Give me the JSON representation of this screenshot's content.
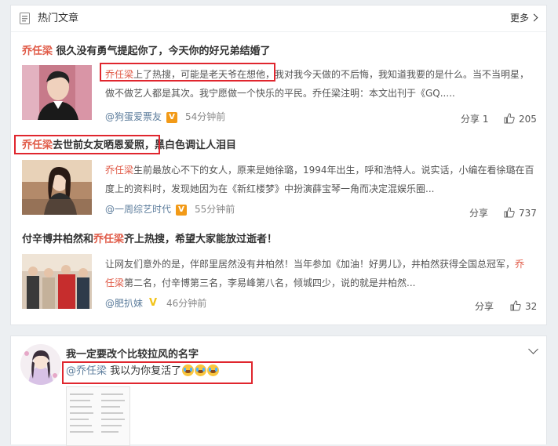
{
  "hot": {
    "header_title": "热门文章",
    "more_label": "更多",
    "articles": [
      {
        "title_highlight": "乔任梁",
        "title_rest": " 很久没有勇气提起你了，今天你的好兄弟结婚了",
        "excerpt_highlight": "乔任梁",
        "excerpt_line1_rest": "上了热搜，可能是老天爷在想他，我对我今天做的不后悔，我知道我要的是什么。当不当明星，",
        "excerpt_line2": "做不做艺人都是其次。我宁愿做一个快乐的平民。乔任梁注明：本文出刊于《GQ.....",
        "author": "@狗蛋爱票友",
        "time": "54分钟前",
        "share": "分享 1",
        "likes": "205"
      },
      {
        "title_highlight": "乔任梁",
        "title_rest": "去世前女友晒恩爱照，黑白色调让人泪目",
        "excerpt_highlight": "乔任梁",
        "excerpt_line1_rest": "生前最放心不下的女人，原来是她徐璐，1994年出生，呼和浩特人。说实话，小编在看徐璐在百",
        "excerpt_line2": "度上的资料时，发现她因为在《新红楼梦》中扮演薛宝琴一角而决定混娱乐圈...",
        "author": "@一周综艺时代",
        "time": "55分钟前",
        "share": "分享",
        "likes": "737"
      },
      {
        "title_pre": "付辛博井柏然和",
        "title_highlight": "乔任梁",
        "title_rest": "齐上热搜，希望大家能放过逝者！",
        "excerpt_line1": "让网友们意外的是，伴郎里居然没有井柏然！当年参加《加油！好男儿》，井柏然获得全国总冠军，",
        "excerpt_line1_hl": "乔",
        "excerpt_line2_hl": "任梁",
        "excerpt_line2_rest": "第二名，付辛博第三名，李易峰第八名，倾城四少，说的就是井柏然...",
        "author": "@肥扒妹",
        "time": "46分钟前",
        "share": "分享",
        "likes": "32"
      }
    ]
  },
  "post": {
    "author_name": "我一定要改个比较拉风的名字",
    "mention": "@乔任梁",
    "text": " 我以为你复活了"
  },
  "icons": {
    "header": "article-icon",
    "more": "chevron-right-icon",
    "verified": "verified-badge-icon",
    "like": "thumbs-up-icon",
    "expand": "chevron-down-icon"
  },
  "colors": {
    "highlight": "#e05a47",
    "link": "#5d7d9c",
    "annotation_box": "#e0262e"
  }
}
